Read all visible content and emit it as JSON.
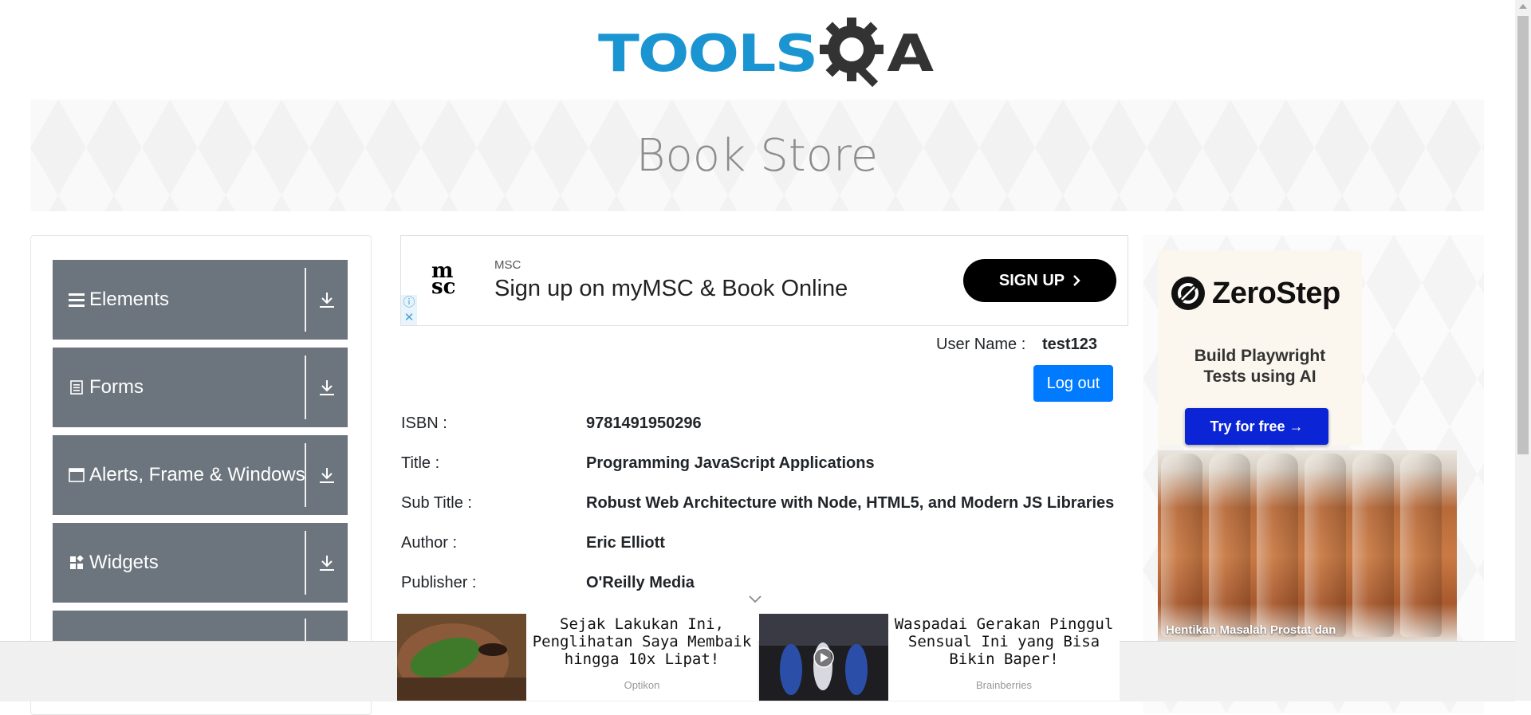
{
  "header": {
    "logo_text": "TOOLSQA",
    "logo_left": "TOOLS",
    "logo_right": "A"
  },
  "banner": {
    "title": "Book Store"
  },
  "sidebar": {
    "groups": [
      {
        "label": "Elements",
        "icon": "hamburger-icon"
      },
      {
        "label": "Forms",
        "icon": "document-icon"
      },
      {
        "label": "Alerts, Frame & Windows",
        "icon": "window-icon"
      },
      {
        "label": "Widgets",
        "icon": "widgets-icon"
      },
      {
        "label": "",
        "icon": ""
      }
    ]
  },
  "ad_top": {
    "brand_logo": "msc",
    "brand": "MSC",
    "headline": "Sign up on myMSC & Book Online",
    "cta": "SIGN UP"
  },
  "user": {
    "label": "User Name :",
    "value": "test123",
    "logout": "Log out"
  },
  "book": [
    {
      "label": "ISBN :",
      "value": "9781491950296"
    },
    {
      "label": "Title :",
      "value": "Programming JavaScript Applications"
    },
    {
      "label": "Sub Title :",
      "value": "Robust Web Architecture with Node, HTML5, and Modern JS Libraries"
    },
    {
      "label": "Author :",
      "value": "Eric Elliott"
    },
    {
      "label": "Publisher :",
      "value": "O'Reilly Media"
    }
  ],
  "right_ads": {
    "zerostep": {
      "name": "ZeroStep",
      "tagline_1": "Build Playwright",
      "tagline_2": "Tests using AI",
      "cta": "Try for free →"
    },
    "bottle_caption": "Hentikan Masalah Prostat dan"
  },
  "bottom_ads": [
    {
      "title": "Sejak Lakukan Ini, Penglihatan Saya Membaik hingga 10x Lipat!",
      "source": "Optikon"
    },
    {
      "title": "Waspadai Gerakan Pinggul Sensual Ini yang Bisa Bikin Baper!",
      "source": "Brainberries"
    }
  ],
  "colors": {
    "accent": "#007bff",
    "sidebar_group": "#6c757d",
    "logo_blue": "#1a95d1",
    "logo_dark": "#333333",
    "zerostep_button": "#0b24d6"
  }
}
